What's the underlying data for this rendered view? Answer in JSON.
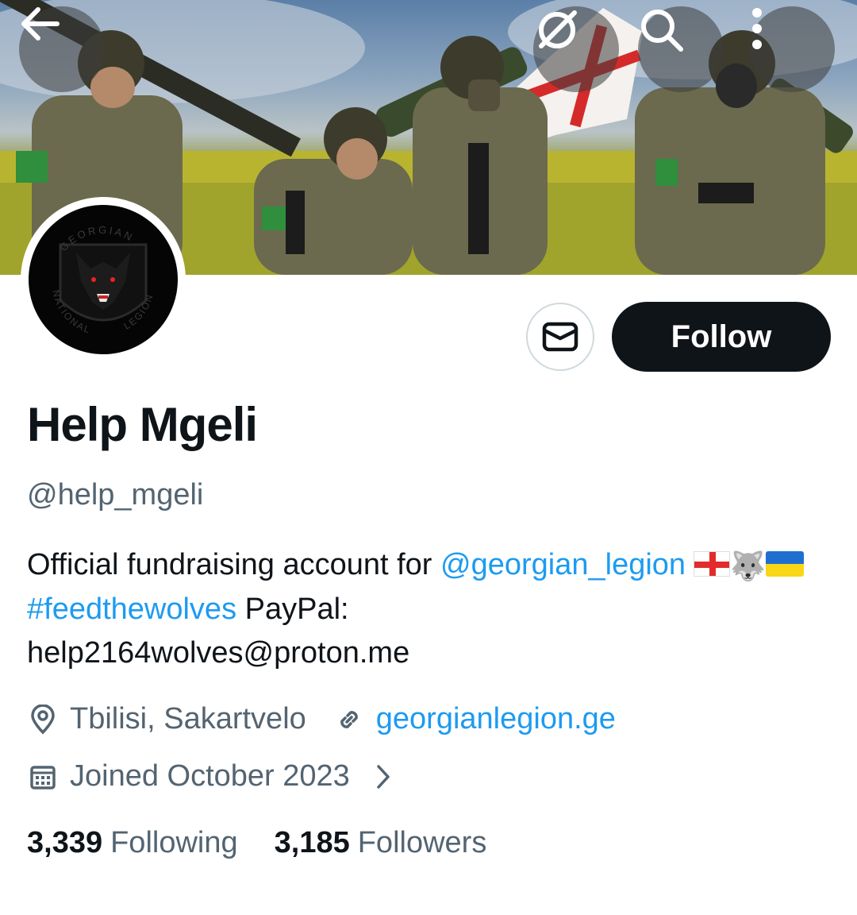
{
  "header": {
    "back_icon": "arrow-left-icon",
    "hide_icon": "eye-slash-icon",
    "search_icon": "search-icon",
    "more_icon": "more-vertical-icon"
  },
  "profile": {
    "display_name": "Help Mgeli",
    "handle": "@help_mgeli",
    "avatar_text_top": "GEORGIAN",
    "avatar_text_bottom_left": "NATIONAL",
    "avatar_text_bottom_right": "LEGION",
    "bio_prefix": "Official fundraising account for ",
    "bio_mention": "@georgian​_legion",
    "bio_hashtag": "#feedthewolves",
    "bio_emoji_wolf": "🐺",
    "bio_paypal_label": " PayPal:",
    "bio_email": "help2164wolves@proton.me",
    "location": "Tbilisi, Sakartvelo",
    "website": "georgianlegion.ge",
    "joined": "Joined October 2023"
  },
  "actions": {
    "message_icon": "mail-icon",
    "follow_label": "Follow"
  },
  "stats": {
    "following_count": "3,339",
    "following_label": "Following",
    "followers_count": "3,185",
    "followers_label": "Followers"
  },
  "colors": {
    "link": "#1d9bf0",
    "text_primary": "#0f1419",
    "text_secondary": "#536471",
    "follow_bg": "#0f1419"
  }
}
